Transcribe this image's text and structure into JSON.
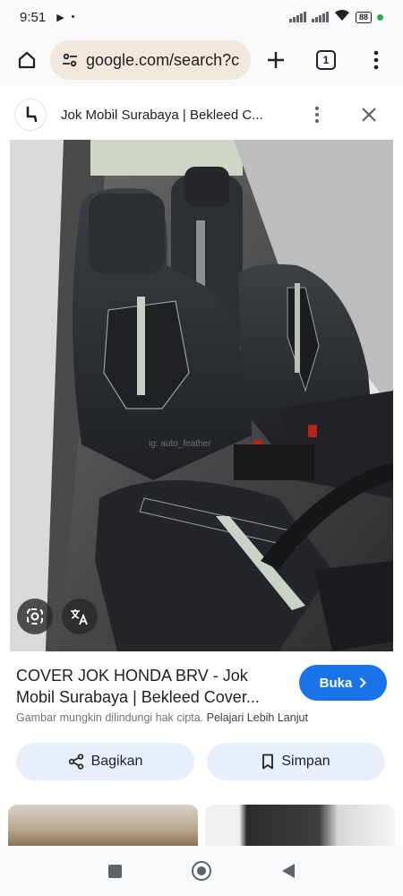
{
  "status_bar": {
    "time": "9:51",
    "battery": "88",
    "icons": [
      "play-icon",
      "dot-icon",
      "signal-icon",
      "signal-icon",
      "wifi-icon",
      "battery-icon",
      "green-dot-icon"
    ]
  },
  "browser": {
    "url": "google.com/search?c",
    "tab_count": "1",
    "icons": [
      "home-icon",
      "tune-icon",
      "plus-icon",
      "tabs-icon",
      "more-vert-icon"
    ]
  },
  "result": {
    "site_title": "Jok Mobil Surabaya | Bekleed C...",
    "image_watermark": "ig: auto_feather",
    "caption_line1": "COVER JOK HONDA BRV - Jok",
    "caption_line2": "Mobil Surabaya | Bekleed Cover...",
    "visit_label": "Buka",
    "notice_text": "Gambar mungkin dilindungi hak cipta.",
    "notice_link": "Pelajari Lebih Lanjut",
    "share_label": "Bagikan",
    "save_label": "Simpan"
  },
  "colors": {
    "accent": "#1a73e8",
    "pill_bg": "#e8eefa",
    "url_bg": "#f1e7dd"
  }
}
